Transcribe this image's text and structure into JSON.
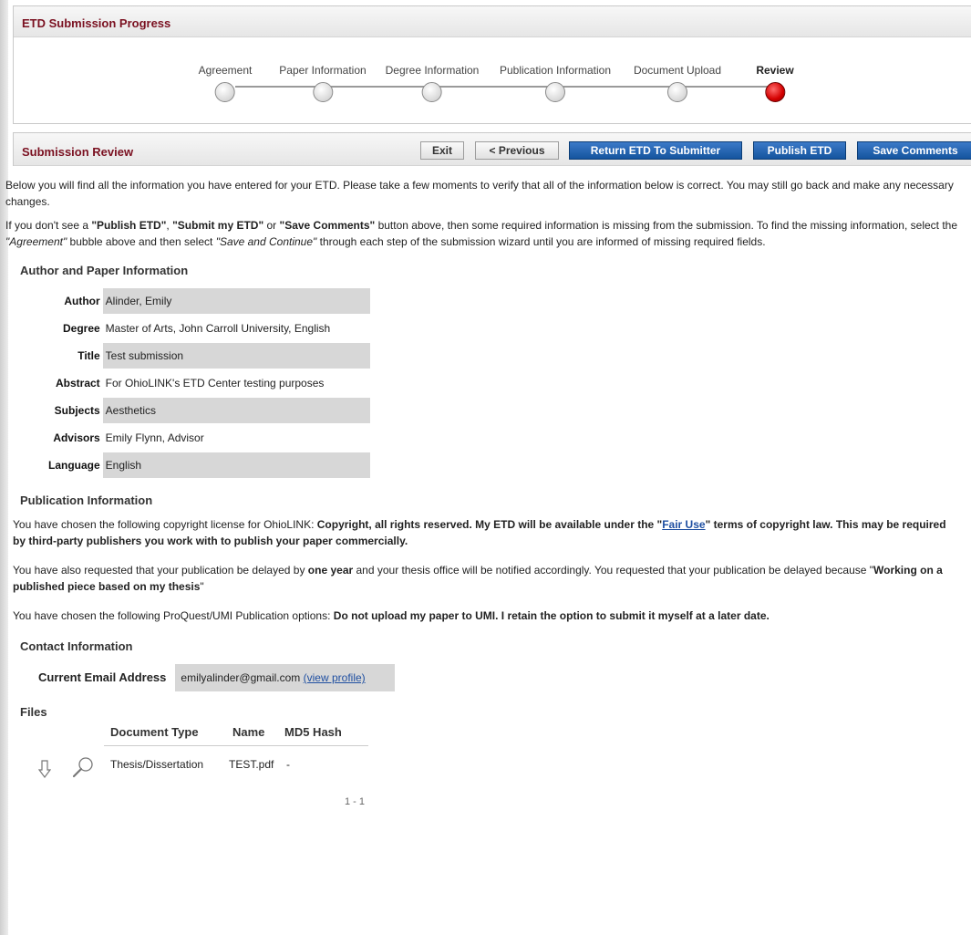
{
  "progress": {
    "title": "ETD Submission Progress",
    "steps": [
      {
        "label": "Agreement"
      },
      {
        "label": "Paper Information"
      },
      {
        "label": "Degree Information"
      },
      {
        "label": "Publication Information"
      },
      {
        "label": "Document Upload"
      },
      {
        "label": "Review"
      }
    ],
    "active": "Review"
  },
  "review": {
    "title": "Submission Review",
    "buttons": {
      "exit": "Exit",
      "previous": "< Previous",
      "return": "Return ETD To Submitter",
      "publish": "Publish ETD",
      "save": "Save Comments"
    },
    "intro1": "Below you will find all the information you have entered for your ETD.  Please take a few moments to verify that all of the information below is correct. You may still go back and make any necessary changes.",
    "intro2": {
      "p1": "If you don't see a ",
      "b1": "\"Publish ETD\"",
      "p2": ", ",
      "b2": "\"Submit my ETD\"",
      "p3": " or ",
      "b3": "\"Save Comments\"",
      "p4": " button above, then some required information is missing from the submission.  To find the missing information, select the ",
      "i1": "\"Agreement\"",
      "p5": " bubble above and then select ",
      "i2": "\"Save and Continue\"",
      "p6": " through each step of the submission wizard until you are informed of missing required fields."
    }
  },
  "author_section": {
    "heading": "Author and Paper Information",
    "rows": [
      {
        "key": "Author",
        "value": "Alinder, Emily"
      },
      {
        "key": "Degree",
        "value": "Master of Arts, John Carroll University, English"
      },
      {
        "key": "Title",
        "value": "Test submission"
      },
      {
        "key": "Abstract",
        "value": "For OhioLINK's ETD Center testing purposes"
      },
      {
        "key": "Subjects",
        "value": "Aesthetics"
      },
      {
        "key": "Advisors",
        "value": "Emily Flynn, Advisor"
      },
      {
        "key": "Language",
        "value": "English"
      }
    ]
  },
  "publication_section": {
    "heading": "Publication Information",
    "license": {
      "pre": "You have chosen the following copyright license for OhioLINK: ",
      "b1": "Copyright, all rights reserved. My ETD will be available under the \"",
      "link": "Fair Use",
      "b2": "\" terms of copyright law. This may be required by third-party publishers you work with to publish your paper commercially."
    },
    "delay": {
      "pre": "You have also requested that your publication be delayed by ",
      "b1": "one year",
      "mid": " and your thesis office will be notified accordingly. You requested that your publication be delayed because \"",
      "b2": "Working on a published piece based on my thesis",
      "post": "\""
    },
    "proquest": {
      "pre": "You have chosen the following ProQuest/UMI Publication options: ",
      "b1": "Do not upload my paper to UMI. I retain the option to submit it myself at a later date."
    }
  },
  "contact_section": {
    "heading": "Contact Information",
    "key": "Current Email Address",
    "email": "emilyalinder@gmail.com",
    "link": "(view profile)"
  },
  "files_section": {
    "heading": "Files",
    "columns": [
      "Document Type",
      "Name",
      "MD5 Hash"
    ],
    "rows": [
      {
        "type": "Thesis/Dissertation",
        "name": "TEST.pdf",
        "hash": "-"
      }
    ],
    "pager": "1 - 1",
    "icons": [
      "download-arrow-icon",
      "magnifier-icon"
    ]
  }
}
